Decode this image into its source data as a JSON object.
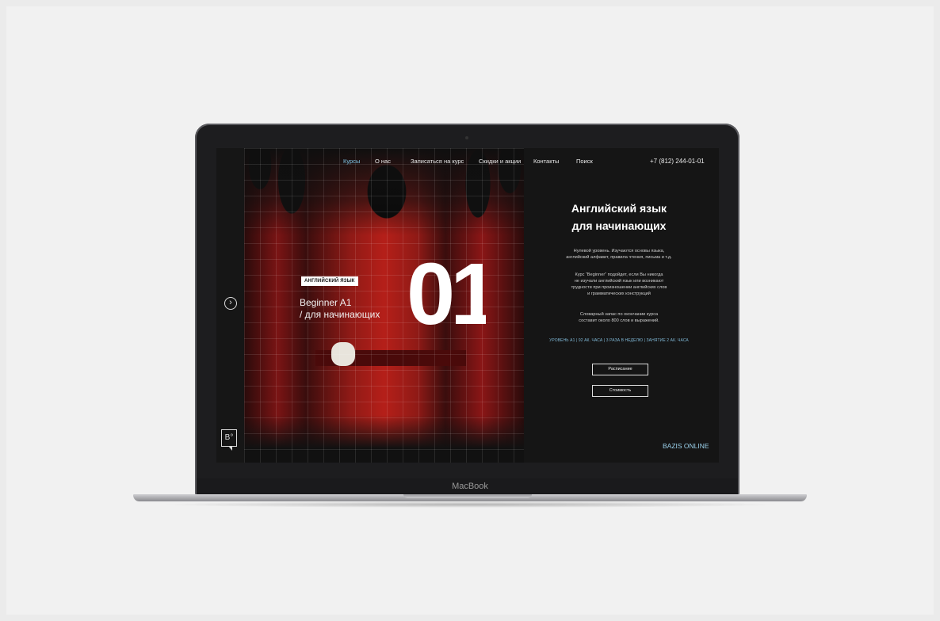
{
  "device": {
    "label": "MacBook"
  },
  "nav": {
    "items": [
      "Курсы",
      "О нас",
      "Записаться на курс",
      "Скидки и акции",
      "Контакты",
      "Поиск"
    ],
    "active_color": "#7fc4e6",
    "phone": "+7 (812) 244-01-01"
  },
  "hero": {
    "tag": "АНГЛИЙСКИЙ ЯЗЫК",
    "course_line1": "Beginner A1",
    "course_line2": "/ для начинающих",
    "number": "01"
  },
  "info": {
    "title_line1": "Английский язык",
    "title_line2": "для начинающих",
    "paragraph1": [
      "Нулевой уровень. Изучаются основы языка,",
      "английский алфавит, правила чтения, письма и т.д."
    ],
    "paragraph2": [
      "Курс “Beginner” подойдет, если Вы никогда",
      "не изучали английский язык или возникают",
      "трудности при произношении английских слов",
      "и грамматических конструкций"
    ],
    "paragraph3": [
      "Словарный запас по окончании курса",
      "составит около 800 слов и выражений."
    ],
    "meta": "УРОВЕНЬ А1 | 92 АК. ЧАСА | 3 РАЗА В НЕДЕЛЮ | ЗАНЯТИЕ 2 АК. ЧАСА",
    "schedule_button": "Расписание",
    "price_button": "Стоимость",
    "brand": "BAZIS ONLINE"
  },
  "sidebar": {
    "logo": "B°",
    "arrow_icon": "chevron-right-circle-icon",
    "logo_icon": "bazis-logo-icon"
  }
}
